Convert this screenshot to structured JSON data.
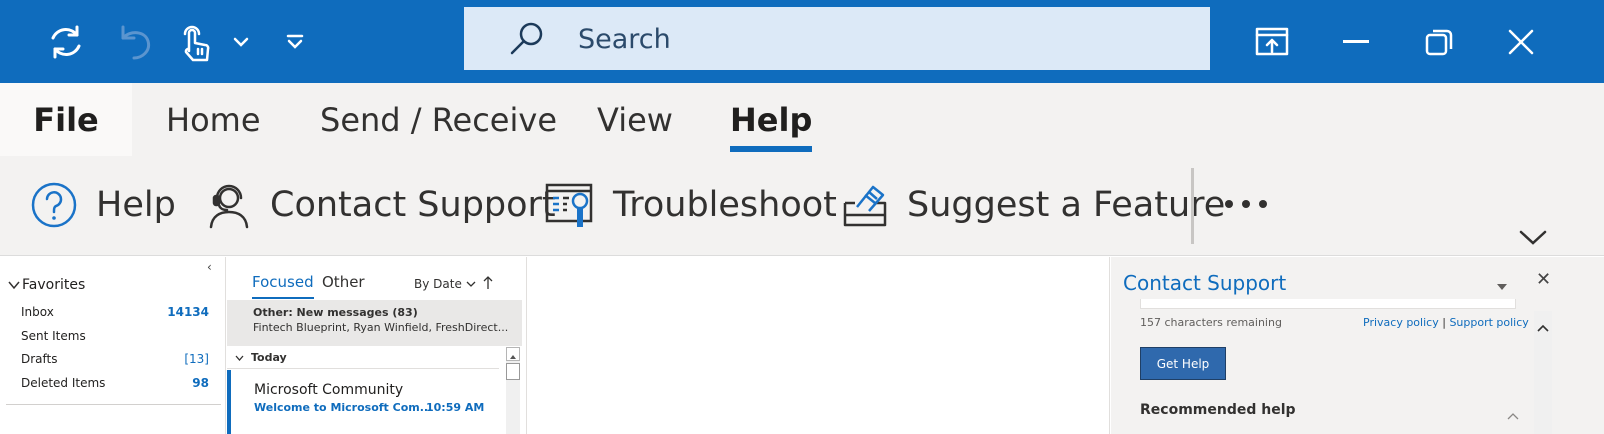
{
  "titlebar": {
    "icons": [
      "sync-icon",
      "undo-icon",
      "touch-mode-icon",
      "chevron-down-icon",
      "customize-toolbar-icon"
    ],
    "search_placeholder": "Search",
    "window_icons": [
      "ribbon-display-icon",
      "minimize-icon",
      "restore-icon",
      "close-icon"
    ],
    "background_color": "#0f6cbd"
  },
  "ribbon": {
    "tabs": [
      {
        "label": "File"
      },
      {
        "label": "Home"
      },
      {
        "label": "Send / Receive"
      },
      {
        "label": "View"
      },
      {
        "label": "Help",
        "active": true
      }
    ],
    "commands": [
      {
        "label": "Help",
        "icon": "help-circle-icon"
      },
      {
        "label": "Contact Support",
        "icon": "headset-icon"
      },
      {
        "label": "Troubleshoot",
        "icon": "troubleshoot-icon"
      },
      {
        "label": "Suggest a Feature",
        "icon": "suggest-feature-icon"
      }
    ],
    "more_icon": "more-icon",
    "collapse_icon": "chevron-down-icon"
  },
  "folders": {
    "favorites_label": "Favorites",
    "items": [
      {
        "label": "Inbox",
        "count": "14134"
      },
      {
        "label": "Sent Items",
        "count": ""
      },
      {
        "label": "Drafts",
        "count": "[13]"
      },
      {
        "label": "Deleted Items",
        "count": "98"
      }
    ]
  },
  "message_list": {
    "tabs": {
      "focused": "Focused",
      "other": "Other"
    },
    "sort_label": "By Date",
    "other_title": "Other: New messages (83)",
    "other_names": "Fintech Blueprint, Ryan Winfield, FreshDirect...",
    "group_header": "Today",
    "messages": [
      {
        "sender": "Microsoft Community",
        "subject": "Welcome to Microsoft Com...",
        "time": "10:59 AM"
      }
    ]
  },
  "support_pane": {
    "title": "Contact Support",
    "chars_remaining": "157 characters remaining",
    "privacy_link": "Privacy policy",
    "separator": "|",
    "support_link": "Support policy",
    "button_label": "Get Help",
    "recommended_label": "Recommended help"
  }
}
